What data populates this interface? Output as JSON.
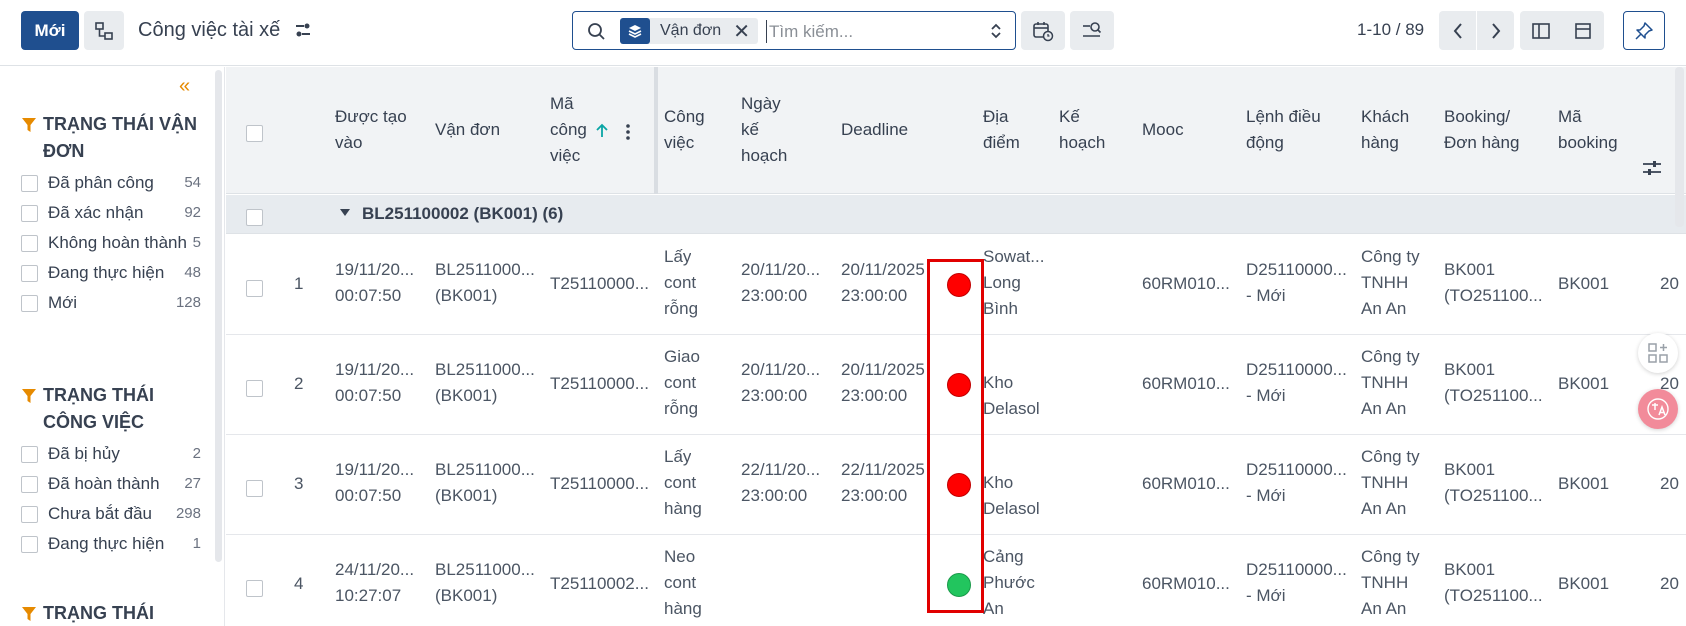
{
  "topbar": {
    "new_label": "Mới",
    "title": "Công việc tài xế",
    "search": {
      "facet_label": "Vận đơn",
      "facet_remove": "✕",
      "placeholder": "Tìm kiếm..."
    },
    "pager": "1-10 / 89"
  },
  "sidebar": {
    "collapse": "«",
    "groups": [
      {
        "title": "TRẠNG THÁI VẬN ĐƠN",
        "items": [
          {
            "label": "Đã phân công",
            "count": "54"
          },
          {
            "label": "Đã xác nhận",
            "count": "92"
          },
          {
            "label": "Không hoàn thành",
            "count": "5"
          },
          {
            "label": "Đang thực hiện",
            "count": "48"
          },
          {
            "label": "Mới",
            "count": "128"
          }
        ]
      },
      {
        "title": "TRẠNG THÁI CÔNG VIỆC",
        "items": [
          {
            "label": "Đã bị hủy",
            "count": "2"
          },
          {
            "label": "Đã hoàn thành",
            "count": "27"
          },
          {
            "label": "Chưa bắt đầu",
            "count": "298"
          },
          {
            "label": "Đang thực hiện",
            "count": "1"
          }
        ]
      },
      {
        "title": "TRẠNG THÁI",
        "items": []
      }
    ]
  },
  "table": {
    "headers": {
      "created": "Được tạo vào",
      "waybill": "Vận đơn",
      "task_code": "Mã công việc",
      "task": "Công việc",
      "plan_date": "Ngày kế hoạch",
      "deadline": "Deadline",
      "location": "Địa điểm",
      "plan": "Kế hoạch",
      "mooc": "Mooc",
      "dispatch": "Lệnh điều động",
      "customer": "Khách hàng",
      "booking_order": "Booking/ Đơn hàng",
      "booking_code": "Mã booking"
    },
    "group": {
      "label": "BL251100002 (BK001) (6)"
    },
    "rows": [
      {
        "num": "1",
        "created_1": "19/11/20...",
        "created_2": "00:07:50",
        "waybill_1": "BL2511000...",
        "waybill_2": "(BK001)",
        "task_code": "T25110000...",
        "task_1": "Lấy",
        "task_2": "cont",
        "task_3": "rỗng",
        "plan_1": "20/11/20...",
        "plan_2": "23:00:00",
        "deadline_1": "20/11/2025",
        "deadline_2": "23:00:00",
        "status_color": "red",
        "loc_1": "Sowat...",
        "loc_2": "Long",
        "loc_3": "Bình",
        "mooc": "60RM010...",
        "dispatch_1": "D25110000...",
        "dispatch_2": "- Mới",
        "cust_1": "Công ty",
        "cust_2": "TNHH",
        "cust_3": "An An",
        "booking_1": "BK001",
        "booking_2": "(TO251100...",
        "booking_code": "BK001",
        "extra": "20"
      },
      {
        "num": "2",
        "created_1": "19/11/20...",
        "created_2": "00:07:50",
        "waybill_1": "BL2511000...",
        "waybill_2": "(BK001)",
        "task_code": "T25110000...",
        "task_1": "Giao",
        "task_2": "cont",
        "task_3": "rỗng",
        "plan_1": "20/11/20...",
        "plan_2": "23:00:00",
        "deadline_1": "20/11/2025",
        "deadline_2": "23:00:00",
        "status_color": "red",
        "loc_1": "",
        "loc_2": "Kho",
        "loc_3": "Delasol",
        "mooc": "60RM010...",
        "dispatch_1": "D25110000...",
        "dispatch_2": "- Mới",
        "cust_1": "Công ty",
        "cust_2": "TNHH",
        "cust_3": "An An",
        "booking_1": "BK001",
        "booking_2": "(TO251100...",
        "booking_code": "BK001",
        "extra": "20"
      },
      {
        "num": "3",
        "created_1": "19/11/20...",
        "created_2": "00:07:50",
        "waybill_1": "BL2511000...",
        "waybill_2": "(BK001)",
        "task_code": "T25110000...",
        "task_1": "Lấy",
        "task_2": "cont",
        "task_3": "hàng",
        "plan_1": "22/11/20...",
        "plan_2": "23:00:00",
        "deadline_1": "22/11/2025",
        "deadline_2": "23:00:00",
        "status_color": "red",
        "loc_1": "",
        "loc_2": "Kho",
        "loc_3": "Delasol",
        "mooc": "60RM010...",
        "dispatch_1": "D25110000...",
        "dispatch_2": "- Mới",
        "cust_1": "Công ty",
        "cust_2": "TNHH",
        "cust_3": "An An",
        "booking_1": "BK001",
        "booking_2": "(TO251100...",
        "booking_code": "BK001",
        "extra": "20"
      },
      {
        "num": "4",
        "created_1": "24/11/20...",
        "created_2": "10:27:07",
        "waybill_1": "BL2511000...",
        "waybill_2": "(BK001)",
        "task_code": "T25110002...",
        "task_1": "Neo",
        "task_2": "cont",
        "task_3": "hàng",
        "plan_1": "",
        "plan_2": "",
        "deadline_1": "",
        "deadline_2": "",
        "status_color": "green",
        "loc_1": "Cảng",
        "loc_2": "Phước",
        "loc_3": "An",
        "mooc": "60RM010...",
        "dispatch_1": "D25110000...",
        "dispatch_2": "- Mới",
        "cust_1": "Công ty",
        "cust_2": "TNHH",
        "cust_3": "An An",
        "booking_1": "BK001",
        "booking_2": "(TO251100...",
        "booking_code": "BK001",
        "extra": "20"
      }
    ]
  },
  "colors": {
    "primary": "#1f4f8f",
    "accent": "#e68a00",
    "status_red": "#ff0000",
    "status_green": "#22c55e",
    "highlight": "#e10000"
  }
}
